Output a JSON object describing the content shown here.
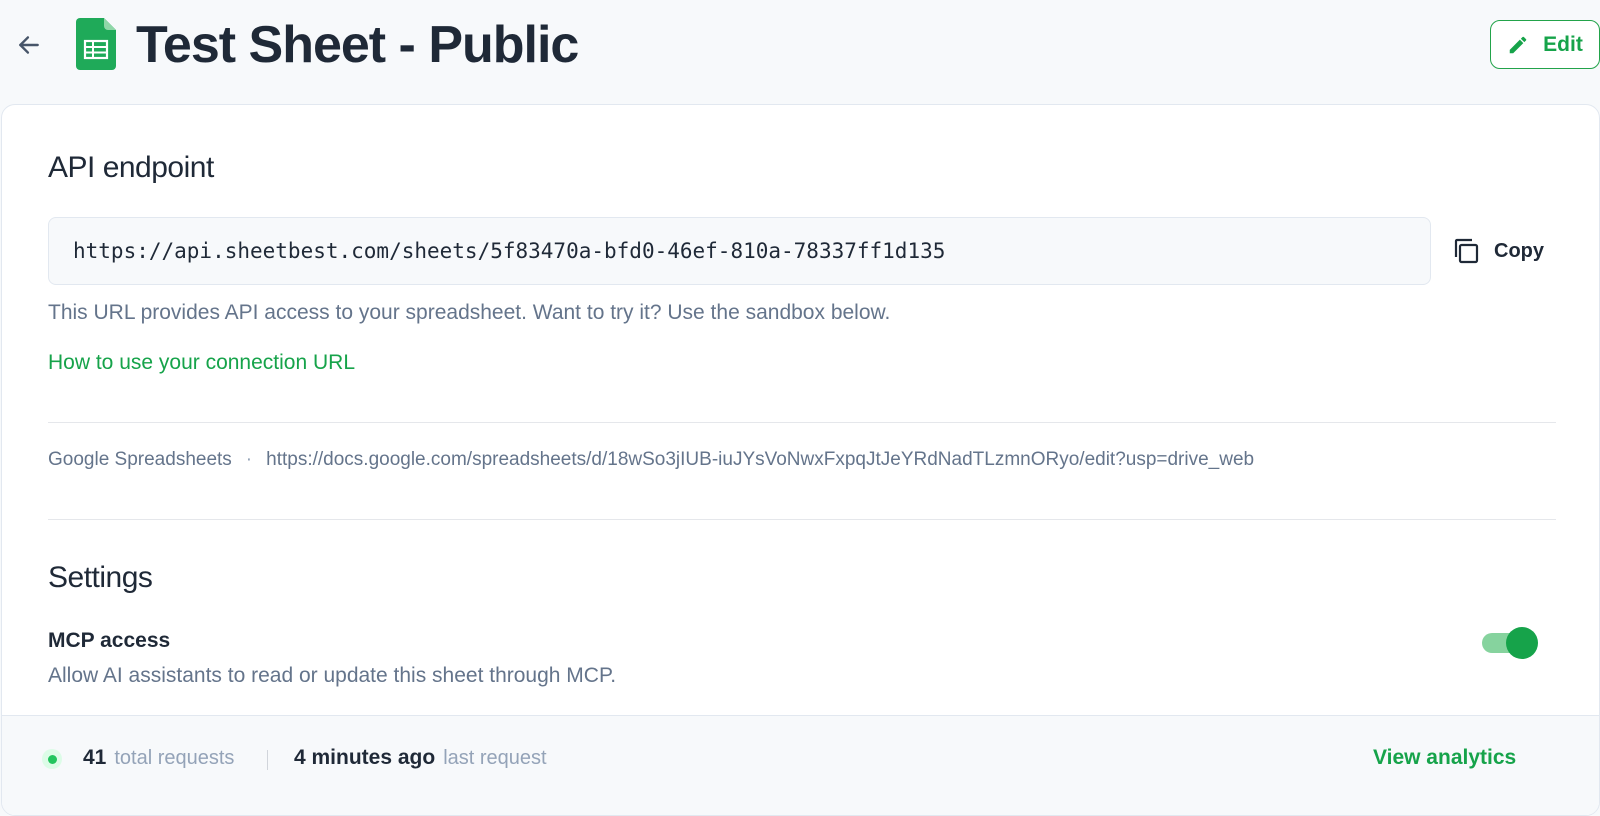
{
  "header": {
    "title": "Test Sheet - Public",
    "back_icon": "arrow-left-icon",
    "sheet_icon": "google-sheets-icon",
    "edit_label": "Edit",
    "edit_icon": "pencil-icon"
  },
  "endpoint": {
    "title": "API endpoint",
    "url": "https://api.sheetbest.com/sheets/5f83470a-bfd0-46ef-810a-78337ff1d135",
    "copy_label": "Copy",
    "copy_icon": "copy-icon",
    "helper_text": "This URL provides API access to your spreadsheet. Want to try it? Use the sandbox below.",
    "how_link": "How to use your connection URL"
  },
  "source": {
    "type": "Google Spreadsheets",
    "separator": "·",
    "url": "https://docs.google.com/spreadsheets/d/18wSo3jIUB-iuJYsVoNwxFxpqJtJeYRdNadTLzmnORyo/edit?usp=drive_web"
  },
  "settings": {
    "title": "Settings",
    "mcp_label": "MCP access",
    "mcp_description": "Allow AI assistants to read or update this sheet through MCP.",
    "mcp_enabled": true
  },
  "footer": {
    "total_requests": "41",
    "total_requests_label": "total requests",
    "last_request": "4 minutes ago",
    "last_request_label": "last request",
    "analytics_link": "View analytics"
  },
  "colors": {
    "accent": "#16a34a",
    "toggle_track": "#86d39e",
    "text_primary": "#1f2937",
    "text_muted": "#64748b",
    "status_dot": "#22c55e"
  }
}
